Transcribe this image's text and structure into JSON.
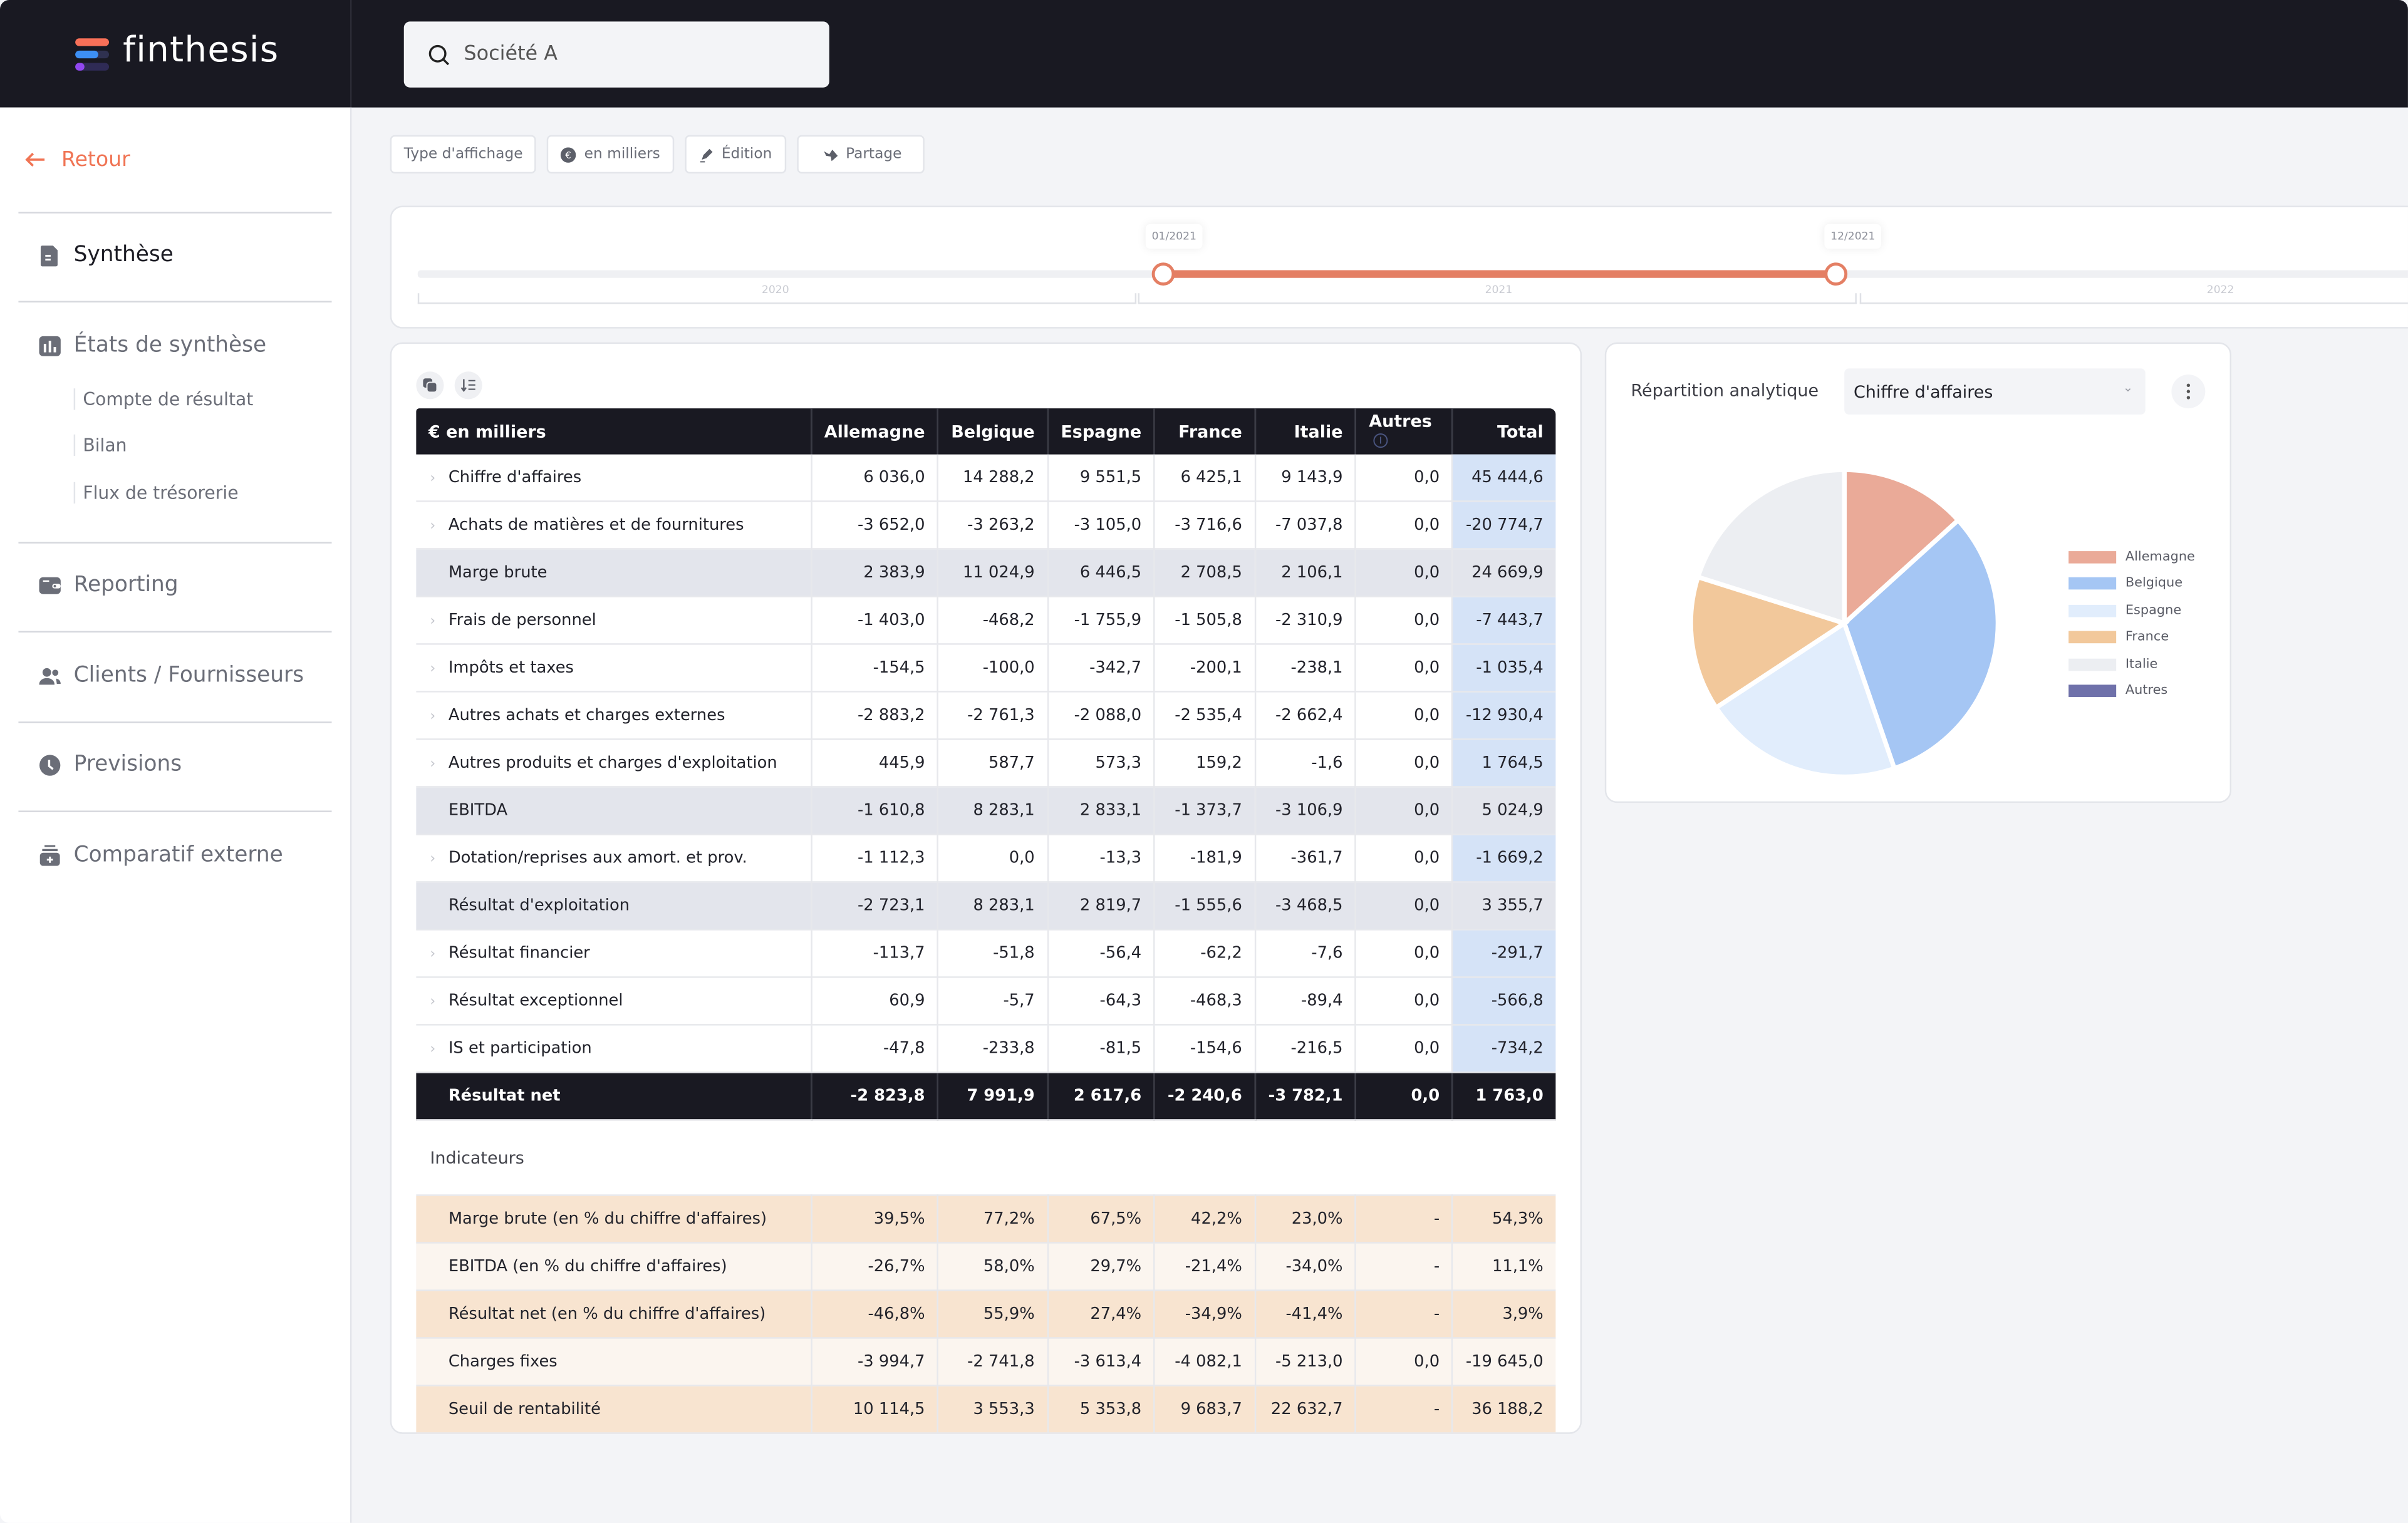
{
  "app": {
    "brand": "finthesis",
    "logo_colors": [
      "#f87058",
      "#3d8ff4",
      "#9147f0"
    ],
    "search_value": "Société A"
  },
  "sidebar": {
    "back_label": "Retour",
    "accent": "#f07454",
    "items": [
      {
        "label": "Synthèse",
        "icon": "document-icon",
        "active": true
      },
      {
        "label": "États de synthèse",
        "icon": "bar-chart-icon",
        "children": [
          "Compte de résultat",
          "Bilan",
          "Flux de trésorerie"
        ]
      },
      {
        "label": "Reporting",
        "icon": "wallet-icon"
      },
      {
        "label": "Clients / Fournisseurs",
        "icon": "users-icon"
      },
      {
        "label": "Previsions",
        "icon": "clock-icon"
      },
      {
        "label": "Comparatif externe",
        "icon": "stack-icon"
      }
    ]
  },
  "toolbar": {
    "display_type": "Type d'affichage",
    "units": "en milliers",
    "edit": "Édition",
    "share": "Partage"
  },
  "timeline": {
    "years": [
      "2020",
      "2021",
      "2022"
    ],
    "start_label": "01/2021",
    "end_label": "12/2021",
    "range_color": "#e47f64"
  },
  "table": {
    "headers": [
      "€ en milliers",
      "Allemagne",
      "Belgique",
      "Espagne",
      "France",
      "Italie",
      "Autres",
      "Total"
    ],
    "rows": [
      {
        "label": "Chiffre d'affaires",
        "type": "detail",
        "values": [
          "6 036,0",
          "14 288,2",
          "9 551,5",
          "6 425,1",
          "9 143,9",
          "0,0",
          "45 444,6"
        ]
      },
      {
        "label": "Achats de matières et de fournitures",
        "type": "detail",
        "values": [
          "-3 652,0",
          "-3 263,2",
          "-3 105,0",
          "-3 716,6",
          "-7 037,8",
          "0,0",
          "-20 774,7"
        ]
      },
      {
        "label": "Marge brute",
        "type": "subtotal",
        "values": [
          "2 383,9",
          "11 024,9",
          "6 446,5",
          "2 708,5",
          "2 106,1",
          "0,0",
          "24 669,9"
        ]
      },
      {
        "label": "Frais de personnel",
        "type": "detail",
        "values": [
          "-1 403,0",
          "-468,2",
          "-1 755,9",
          "-1 505,8",
          "-2 310,9",
          "0,0",
          "-7 443,7"
        ]
      },
      {
        "label": "Impôts et taxes",
        "type": "detail",
        "values": [
          "-154,5",
          "-100,0",
          "-342,7",
          "-200,1",
          "-238,1",
          "0,0",
          "-1 035,4"
        ]
      },
      {
        "label": "Autres achats et charges externes",
        "type": "detail",
        "values": [
          "-2 883,2",
          "-2 761,3",
          "-2 088,0",
          "-2 535,4",
          "-2 662,4",
          "0,0",
          "-12 930,4"
        ]
      },
      {
        "label": "Autres produits et charges d'exploitation",
        "type": "detail",
        "values": [
          "445,9",
          "587,7",
          "573,3",
          "159,2",
          "-1,6",
          "0,0",
          "1 764,5"
        ]
      },
      {
        "label": "EBITDA",
        "type": "subtotal",
        "values": [
          "-1 610,8",
          "8 283,1",
          "2 833,1",
          "-1 373,7",
          "-3 106,9",
          "0,0",
          "5 024,9"
        ]
      },
      {
        "label": "Dotation/reprises aux amort. et prov.",
        "type": "detail",
        "values": [
          "-1 112,3",
          "0,0",
          "-13,3",
          "-181,9",
          "-361,7",
          "0,0",
          "-1 669,2"
        ]
      },
      {
        "label": "Résultat d'exploitation",
        "type": "subtotal",
        "values": [
          "-2 723,1",
          "8 283,1",
          "2 819,7",
          "-1 555,6",
          "-3 468,5",
          "0,0",
          "3 355,7"
        ]
      },
      {
        "label": "Résultat financier",
        "type": "detail",
        "values": [
          "-113,7",
          "-51,8",
          "-56,4",
          "-62,2",
          "-7,6",
          "0,0",
          "-291,7"
        ]
      },
      {
        "label": "Résultat exceptionnel",
        "type": "detail",
        "values": [
          "60,9",
          "-5,7",
          "-64,3",
          "-468,3",
          "-89,4",
          "0,0",
          "-566,8"
        ]
      },
      {
        "label": "IS et participation",
        "type": "detail",
        "values": [
          "-47,8",
          "-233,8",
          "-81,5",
          "-154,6",
          "-216,5",
          "0,0",
          "-734,2"
        ]
      },
      {
        "label": "Résultat net",
        "type": "net",
        "values": [
          "-2 823,8",
          "7 991,9",
          "2 617,6",
          "-2 240,6",
          "-3 782,1",
          "0,0",
          "1 763,0"
        ]
      }
    ],
    "indicators_title": "Indicateurs",
    "indicators": [
      {
        "label": "Marge brute (en % du chiffre d'affaires)",
        "values": [
          "39,5%",
          "77,2%",
          "67,5%",
          "42,2%",
          "23,0%",
          "-",
          "54,3%"
        ]
      },
      {
        "label": "EBITDA (en % du chiffre d'affaires)",
        "values": [
          "-26,7%",
          "58,0%",
          "29,7%",
          "-21,4%",
          "-34,0%",
          "-",
          "11,1%"
        ]
      },
      {
        "label": "Résultat net (en % du chiffre d'affaires)",
        "values": [
          "-46,8%",
          "55,9%",
          "27,4%",
          "-34,9%",
          "-41,4%",
          "-",
          "3,9%"
        ]
      },
      {
        "label": "Charges fixes",
        "values": [
          "-3 994,7",
          "-2 741,8",
          "-3 613,4",
          "-4 082,1",
          "-5 213,0",
          "0,0",
          "-19 645,0"
        ]
      },
      {
        "label": "Seuil de rentabilité",
        "values": [
          "10 114,5",
          "3 553,3",
          "5 353,8",
          "9 683,7",
          "22 632,7",
          "-",
          "36 188,2"
        ]
      }
    ]
  },
  "pie_panel": {
    "title": "Répartition analytique",
    "selected_metric": "Chiffre d'affaires"
  },
  "chart_data": {
    "type": "pie",
    "title": "Répartition analytique — Chiffre d'affaires",
    "categories": [
      "Allemagne",
      "Belgique",
      "Espagne",
      "France",
      "Italie",
      "Autres"
    ],
    "values": [
      6036.0,
      14288.2,
      9551.5,
      6425.1,
      9143.9,
      0.0
    ],
    "colors": [
      "#eaaa98",
      "#a5c6f4",
      "#e1edfc",
      "#f2c89b",
      "#eceef2",
      "#6f71aa"
    ],
    "legend": "right"
  }
}
